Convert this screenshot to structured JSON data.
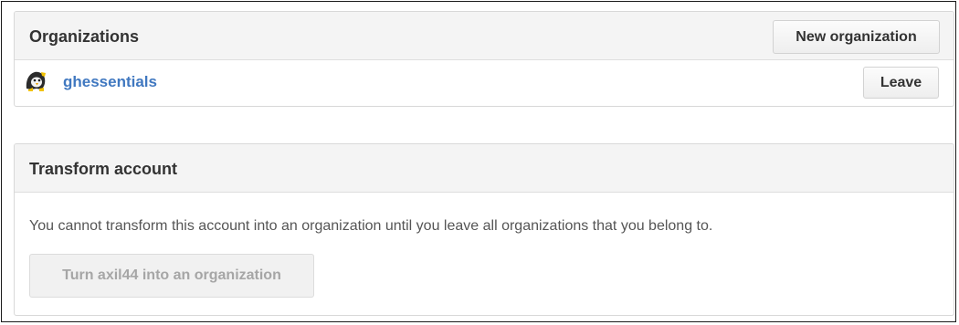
{
  "organizations": {
    "title": "Organizations",
    "new_button_label": "New organization",
    "items": [
      {
        "name": "ghessentials",
        "leave_label": "Leave",
        "avatar_icon": "octocat-penguin-avatar-icon"
      }
    ]
  },
  "transform": {
    "title": "Transform account",
    "message": "You cannot transform this account into an organization until you leave all organizations that you belong to.",
    "button_label": "Turn axil44 into an organization",
    "button_disabled": true
  },
  "colors": {
    "link": "#4078c0",
    "header_bg": "#f4f4f4",
    "border": "#d8d8d8",
    "disabled_text": "#a6a6a6"
  }
}
